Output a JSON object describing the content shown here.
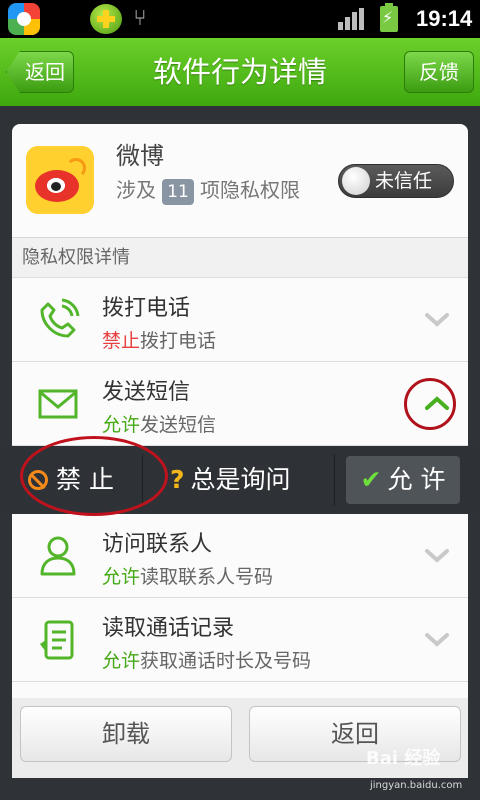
{
  "status_bar": {
    "time": "19:14"
  },
  "titlebar": {
    "back_label": "返回",
    "title": "软件行为详情",
    "feedback_label": "反馈"
  },
  "app": {
    "name": "微博",
    "desc_prefix": "涉及",
    "count": "11",
    "desc_suffix": "项隐私权限",
    "trust_label": "未信任"
  },
  "section_title": "隐私权限详情",
  "permissions": [
    {
      "icon": "phone-icon",
      "name": "拨打电话",
      "status": "禁止",
      "status_rest": "拨打电话",
      "status_color": "#e84040"
    },
    {
      "icon": "mail-icon",
      "name": "发送短信",
      "status": "允许",
      "status_rest": "发送短信",
      "status_color": "#45a815"
    },
    {
      "icon": "contacts-icon",
      "name": "访问联系人",
      "status": "允许",
      "status_rest": "读取联系人号码",
      "status_color": "#45a815"
    },
    {
      "icon": "call-log-icon",
      "name": "读取通话记录",
      "status": "允许",
      "status_rest": "获取通话时长及号码",
      "status_color": "#45a815"
    }
  ],
  "actions": {
    "deny": "禁 止",
    "ask": "总是询问",
    "allow": "允 许"
  },
  "bottom": {
    "uninstall": "卸载",
    "back": "返回"
  },
  "watermark": {
    "text": "Bai 经验",
    "sub": "jingyan.baidu.com"
  }
}
